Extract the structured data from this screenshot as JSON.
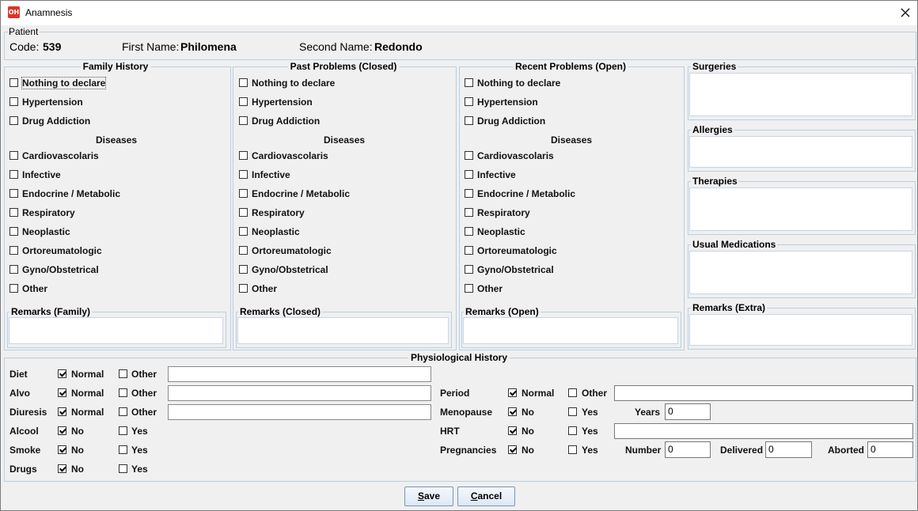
{
  "window": {
    "title": "Anamnesis",
    "app_icon": "OH"
  },
  "patient": {
    "legend": "Patient",
    "code_label": "Code:",
    "code_value": "539",
    "first_name_label": "First Name:",
    "first_name_value": "Philomena",
    "second_name_label": "Second Name:",
    "second_name_value": "Redondo"
  },
  "family": {
    "legend": "Family History",
    "top_items": [
      "Nothing to declare",
      "Hypertension",
      "Drug Addiction"
    ],
    "diseases_title": "Diseases",
    "disease_items": [
      "Cardiovascolaris",
      "Infective",
      "Endocrine / Metabolic",
      "Respiratory",
      "Neoplastic",
      "Ortoreumatologic",
      "Gyno/Obstetrical",
      "Other"
    ],
    "remarks_legend": "Remarks (Family)"
  },
  "closed": {
    "legend": "Past Problems (Closed)",
    "top_items": [
      "Nothing to declare",
      "Hypertension",
      "Drug Addiction"
    ],
    "diseases_title": "Diseases",
    "disease_items": [
      "Cardiovascolaris",
      "Infective",
      "Endocrine / Metabolic",
      "Respiratory",
      "Neoplastic",
      "Ortoreumatologic",
      "Gyno/Obstetrical",
      "Other"
    ],
    "remarks_legend": "Remarks (Closed)"
  },
  "open": {
    "legend": "Recent Problems (Open)",
    "top_items": [
      "Nothing to declare",
      "Hypertension",
      "Drug Addiction"
    ],
    "diseases_title": "Diseases",
    "disease_items": [
      "Cardiovascolaris",
      "Infective",
      "Endocrine / Metabolic",
      "Respiratory",
      "Neoplastic",
      "Ortoreumatologic",
      "Gyno/Obstetrical",
      "Other"
    ],
    "remarks_legend": "Remarks (Open)"
  },
  "right": {
    "surgeries": "Surgeries",
    "allergies": "Allergies",
    "therapies": "Therapies",
    "usual_medications": "Usual Medications",
    "remarks_extra": "Remarks (Extra)"
  },
  "physio": {
    "legend": "Physiological History",
    "left_rows": [
      {
        "label": "Diet",
        "opt1": "Normal",
        "opt1_checked": true,
        "opt2": "Other",
        "opt2_checked": false,
        "has_field": true,
        "field_value": ""
      },
      {
        "label": "Alvo",
        "opt1": "Normal",
        "opt1_checked": true,
        "opt2": "Other",
        "opt2_checked": false,
        "has_field": true,
        "field_value": ""
      },
      {
        "label": "Diuresis",
        "opt1": "Normal",
        "opt1_checked": true,
        "opt2": "Other",
        "opt2_checked": false,
        "has_field": true,
        "field_value": ""
      },
      {
        "label": "Alcool",
        "opt1": "No",
        "opt1_checked": true,
        "opt2": "Yes",
        "opt2_checked": false,
        "has_field": false
      },
      {
        "label": "Smoke",
        "opt1": "No",
        "opt1_checked": true,
        "opt2": "Yes",
        "opt2_checked": false,
        "has_field": false
      },
      {
        "label": "Drugs",
        "opt1": "No",
        "opt1_checked": true,
        "opt2": "Yes",
        "opt2_checked": false,
        "has_field": false
      }
    ],
    "period": {
      "label": "Period",
      "opt1": "Normal",
      "opt2": "Other",
      "field_value": ""
    },
    "menopause": {
      "label": "Menopause",
      "opt1": "No",
      "opt2": "Yes",
      "years_label": "Years",
      "years_value": "0"
    },
    "hrt": {
      "label": "HRT",
      "opt1": "No",
      "opt2": "Yes",
      "field_value": ""
    },
    "pregnancies": {
      "label": "Pregnancies",
      "opt1": "No",
      "opt2": "Yes",
      "number_label": "Number",
      "number_value": "0",
      "delivered_label": "Delivered",
      "delivered_value": "0",
      "aborted_label": "Aborted",
      "aborted_value": "0"
    }
  },
  "buttons": {
    "save_mnemonic": "S",
    "save_rest": "ave",
    "cancel_mnemonic": "C",
    "cancel_rest": "ancel"
  }
}
